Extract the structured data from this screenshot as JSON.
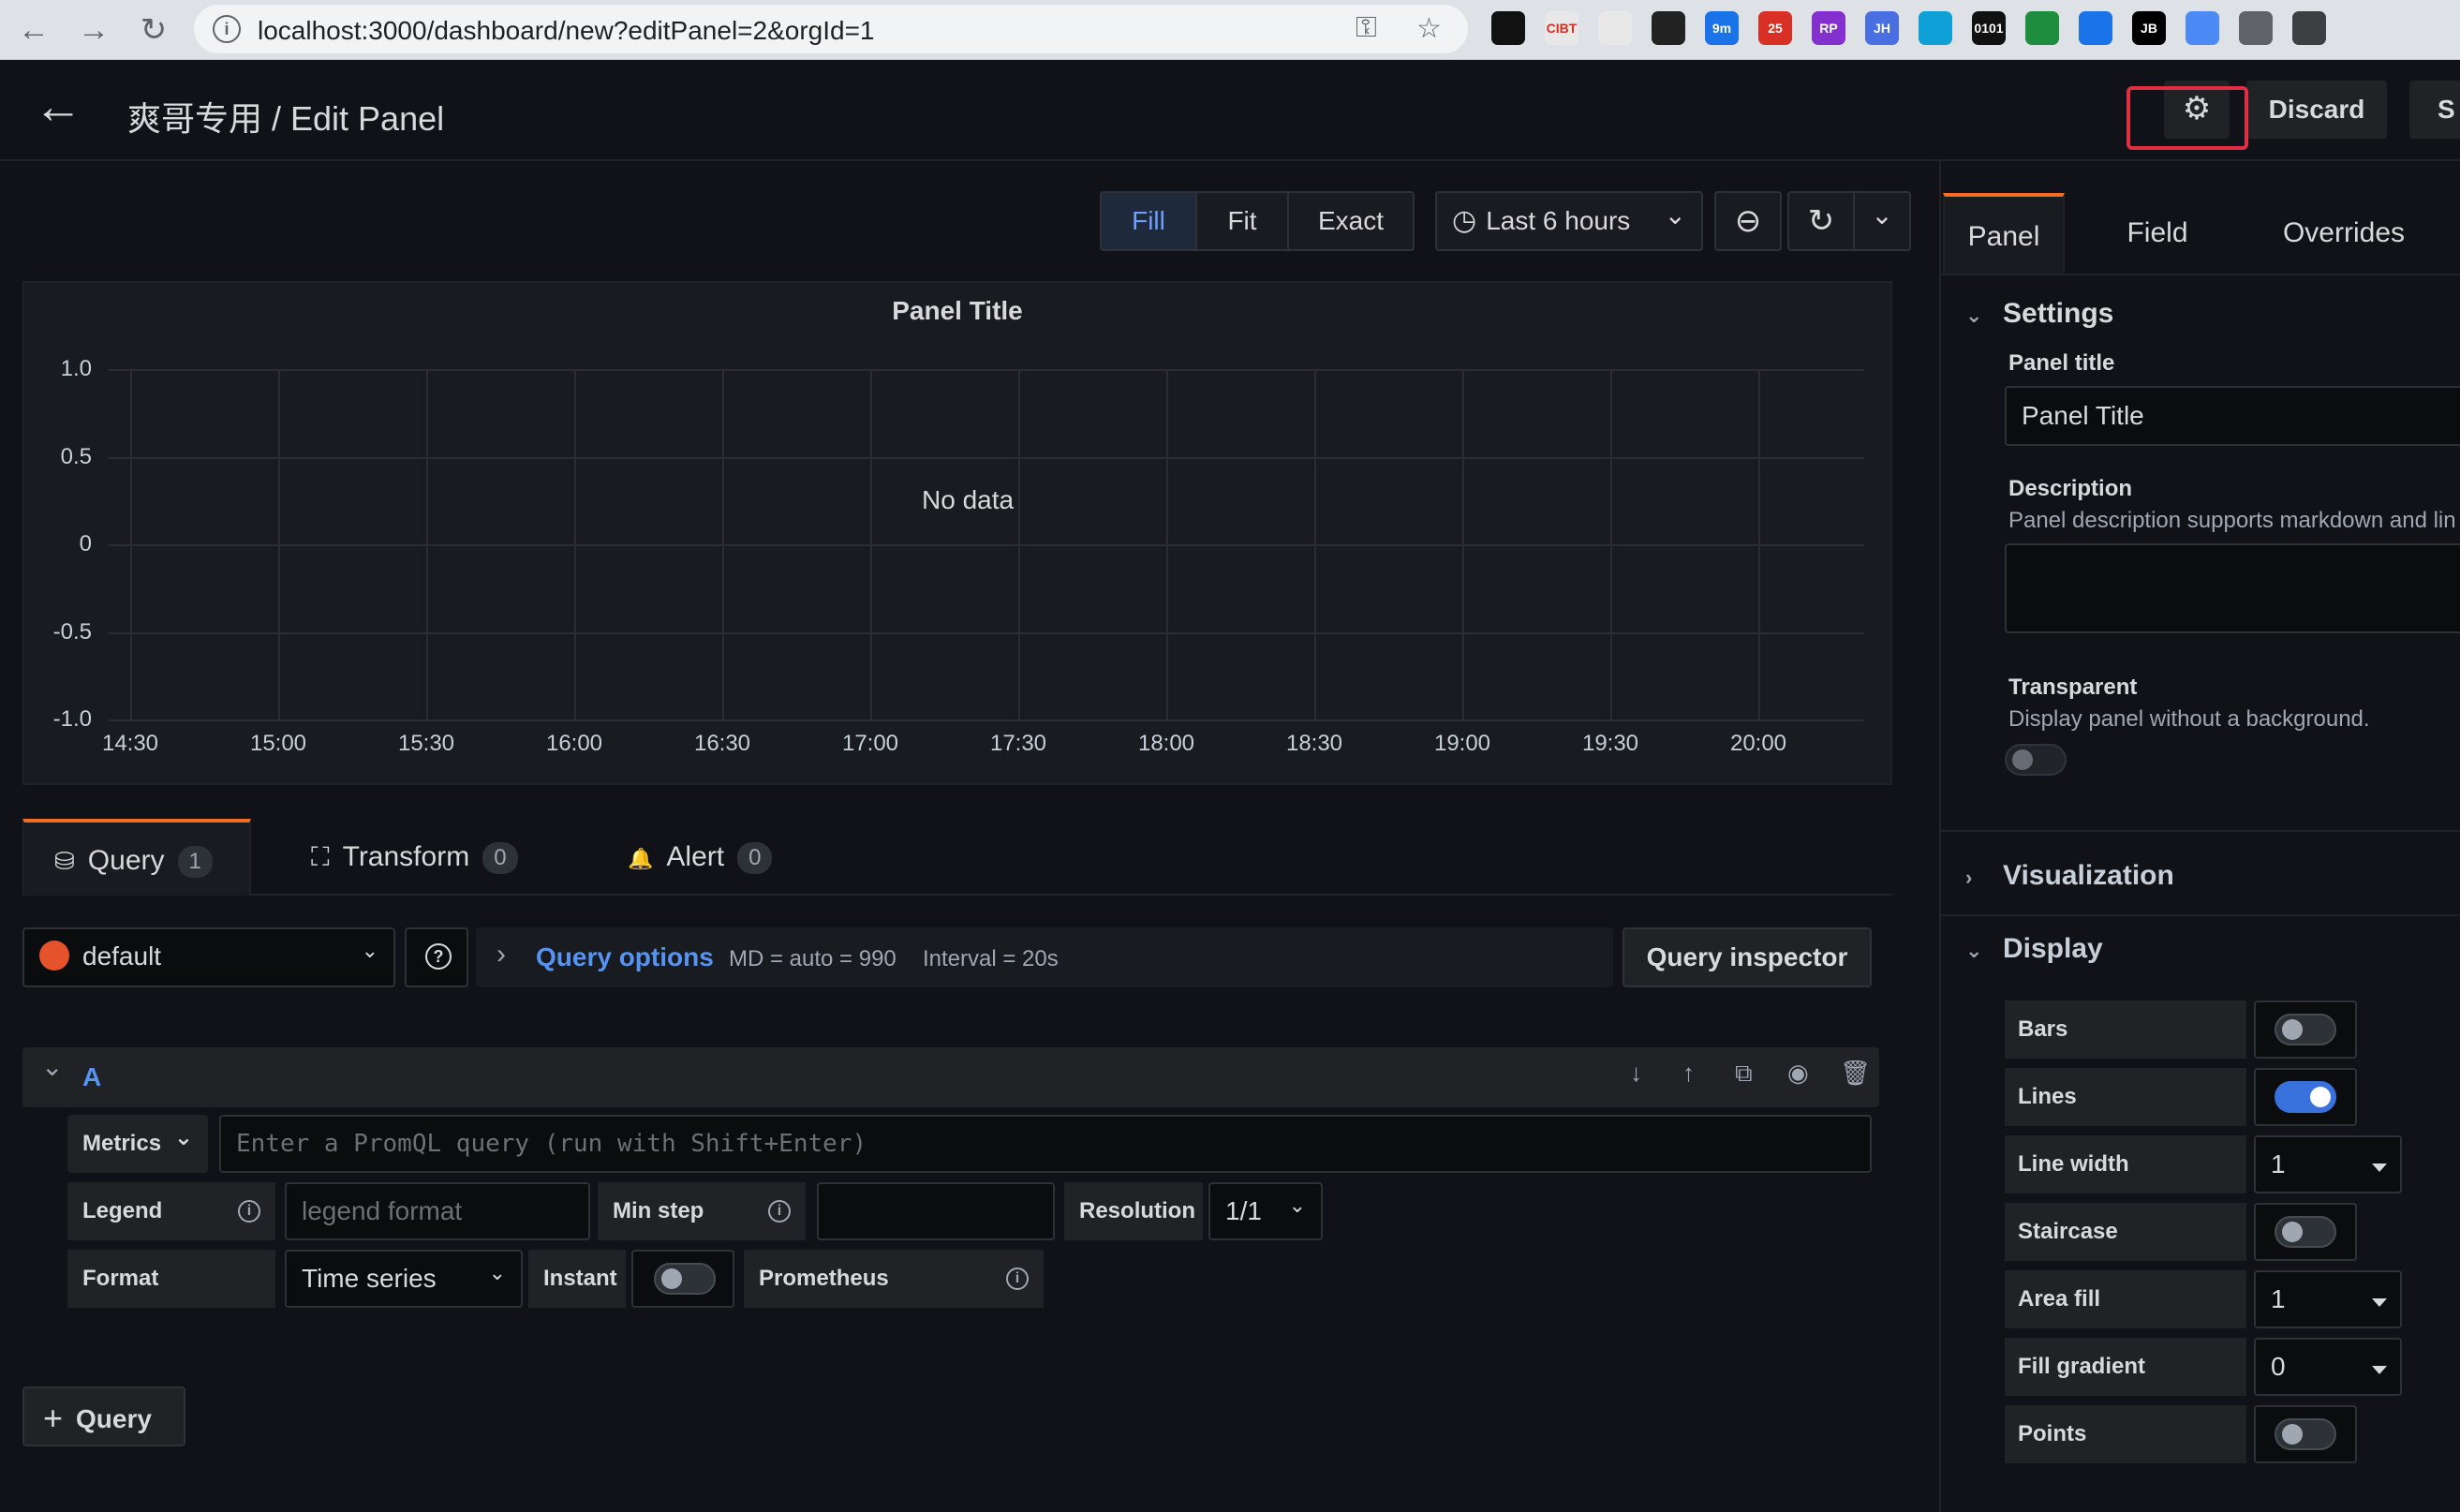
{
  "browser": {
    "url": "localhost:3000/dashboard/new?editPanel=2&orgId=1",
    "info_glyph": "i",
    "back_glyph": "←",
    "forward_glyph": "→",
    "reload_glyph": "↻",
    "key_glyph": "⚿",
    "star_glyph": "☆",
    "extensions": [
      {
        "name": "github-ext-icon",
        "label": "",
        "color": "#111111"
      },
      {
        "name": "ext-cibt-icon",
        "label": "CIBT",
        "color": "#e8e8e8"
      },
      {
        "name": "ext-red-icon",
        "label": "",
        "color": "#e8e8e8"
      },
      {
        "name": "ext-color-icon",
        "label": "",
        "color": "#222222"
      },
      {
        "name": "ext-9m-icon",
        "label": "9m",
        "color": "#1a73e8"
      },
      {
        "name": "ext-25-icon",
        "label": "25",
        "color": "#d93025"
      },
      {
        "name": "ext-rp-icon",
        "label": "RP",
        "color": "#8430ce"
      },
      {
        "name": "ext-jh-icon",
        "label": "JH",
        "color": "#4a6fe3"
      },
      {
        "name": "ext-filter-icon",
        "label": "",
        "color": "#0fa0d8"
      },
      {
        "name": "ext-binary-icon",
        "label": "0101",
        "color": "#111111"
      },
      {
        "name": "ext-shield-icon",
        "label": "",
        "color": "#1e8e3e"
      },
      {
        "name": "ext-blue-icon",
        "label": "",
        "color": "#1a73e8"
      },
      {
        "name": "ext-jb-icon",
        "label": "JB",
        "color": "#000000"
      },
      {
        "name": "ext-pen-icon",
        "label": "",
        "color": "#4c8bf5"
      },
      {
        "name": "ext-globe-icon",
        "label": "",
        "color": "#5f6368"
      },
      {
        "name": "ext-qr-icon",
        "label": "",
        "color": "#3c4043"
      }
    ]
  },
  "topbar": {
    "back_glyph": "←",
    "title": "爽哥专用 / Edit Panel",
    "settings_glyph": "⚙",
    "discard_label": "Discard",
    "save_label": "S"
  },
  "toolbar": {
    "fill": "Fill",
    "fit": "Fit",
    "exact": "Exact",
    "time_range": "Last 6 hours",
    "clock_glyph": "◷",
    "chevron": "⌄",
    "zoom_glyph": "⊖",
    "refresh_glyph": "↻"
  },
  "chart_data": {
    "type": "line",
    "title": "Panel Title",
    "empty_message": "No data",
    "x": [
      "14:30",
      "15:00",
      "15:30",
      "16:00",
      "16:30",
      "17:00",
      "17:30",
      "18:00",
      "18:30",
      "19:00",
      "19:30",
      "20:00"
    ],
    "yticks": [
      "1.0",
      "0.5",
      "0",
      "-0.5",
      "-1.0"
    ],
    "ylim": [
      -1.0,
      1.0
    ],
    "series": [],
    "grid": true
  },
  "query_tabs": [
    {
      "label": "Query",
      "count": "1",
      "glyph": "⛁"
    },
    {
      "label": "Transform",
      "count": "0",
      "glyph": "⛶"
    },
    {
      "label": "Alert",
      "count": "0",
      "glyph": "🔔"
    }
  ],
  "datasource": {
    "name": "default",
    "help_glyph": "?",
    "options_label": "Query options",
    "options_arrow": "›",
    "md": "MD = auto = 990",
    "interval": "Interval = 20s",
    "inspector": "Query inspector"
  },
  "query_row": {
    "ref": "A",
    "collapse_glyph": "⌄",
    "actions": [
      {
        "name": "move-down-icon",
        "glyph": "↓"
      },
      {
        "name": "move-up-icon",
        "glyph": "↑"
      },
      {
        "name": "duplicate-icon",
        "glyph": "⧉"
      },
      {
        "name": "eye-icon",
        "glyph": "◉"
      },
      {
        "name": "trash-icon",
        "glyph": "🗑"
      }
    ],
    "metrics_label": "Metrics",
    "query_placeholder": "Enter a PromQL query (run with Shift+Enter)",
    "legend_label": "Legend",
    "legend_placeholder": "legend format",
    "min_step_label": "Min step",
    "resolution_label": "Resolution",
    "resolution_value": "1/1",
    "format_label": "Format",
    "format_value": "Time series",
    "instant_label": "Instant",
    "prometheus_label": "Prometheus",
    "info_glyph": "i",
    "instant_on": false
  },
  "add_query": {
    "plus": "+",
    "label": "Query"
  },
  "right_pane": {
    "tabs": [
      "Panel",
      "Field",
      "Overrides"
    ],
    "settings_header": "Settings",
    "panel_title_label": "Panel title",
    "panel_title_value": "Panel Title",
    "description_label": "Description",
    "description_hint": "Panel description supports markdown and lin",
    "transparent_label": "Transparent",
    "transparent_hint": "Display panel without a background.",
    "visualization_header": "Visualization",
    "display_header": "Display",
    "open_arrow": "⌄",
    "closed_arrow": "›",
    "display_options": [
      {
        "label": "Bars",
        "kind": "toggle",
        "on": false
      },
      {
        "label": "Lines",
        "kind": "toggle",
        "on": true
      },
      {
        "label": "Line width",
        "kind": "select",
        "value": "1"
      },
      {
        "label": "Staircase",
        "kind": "toggle",
        "on": false
      },
      {
        "label": "Area fill",
        "kind": "select",
        "value": "1"
      },
      {
        "label": "Fill gradient",
        "kind": "select",
        "value": "0"
      },
      {
        "label": "Points",
        "kind": "toggle",
        "on": false
      }
    ]
  }
}
